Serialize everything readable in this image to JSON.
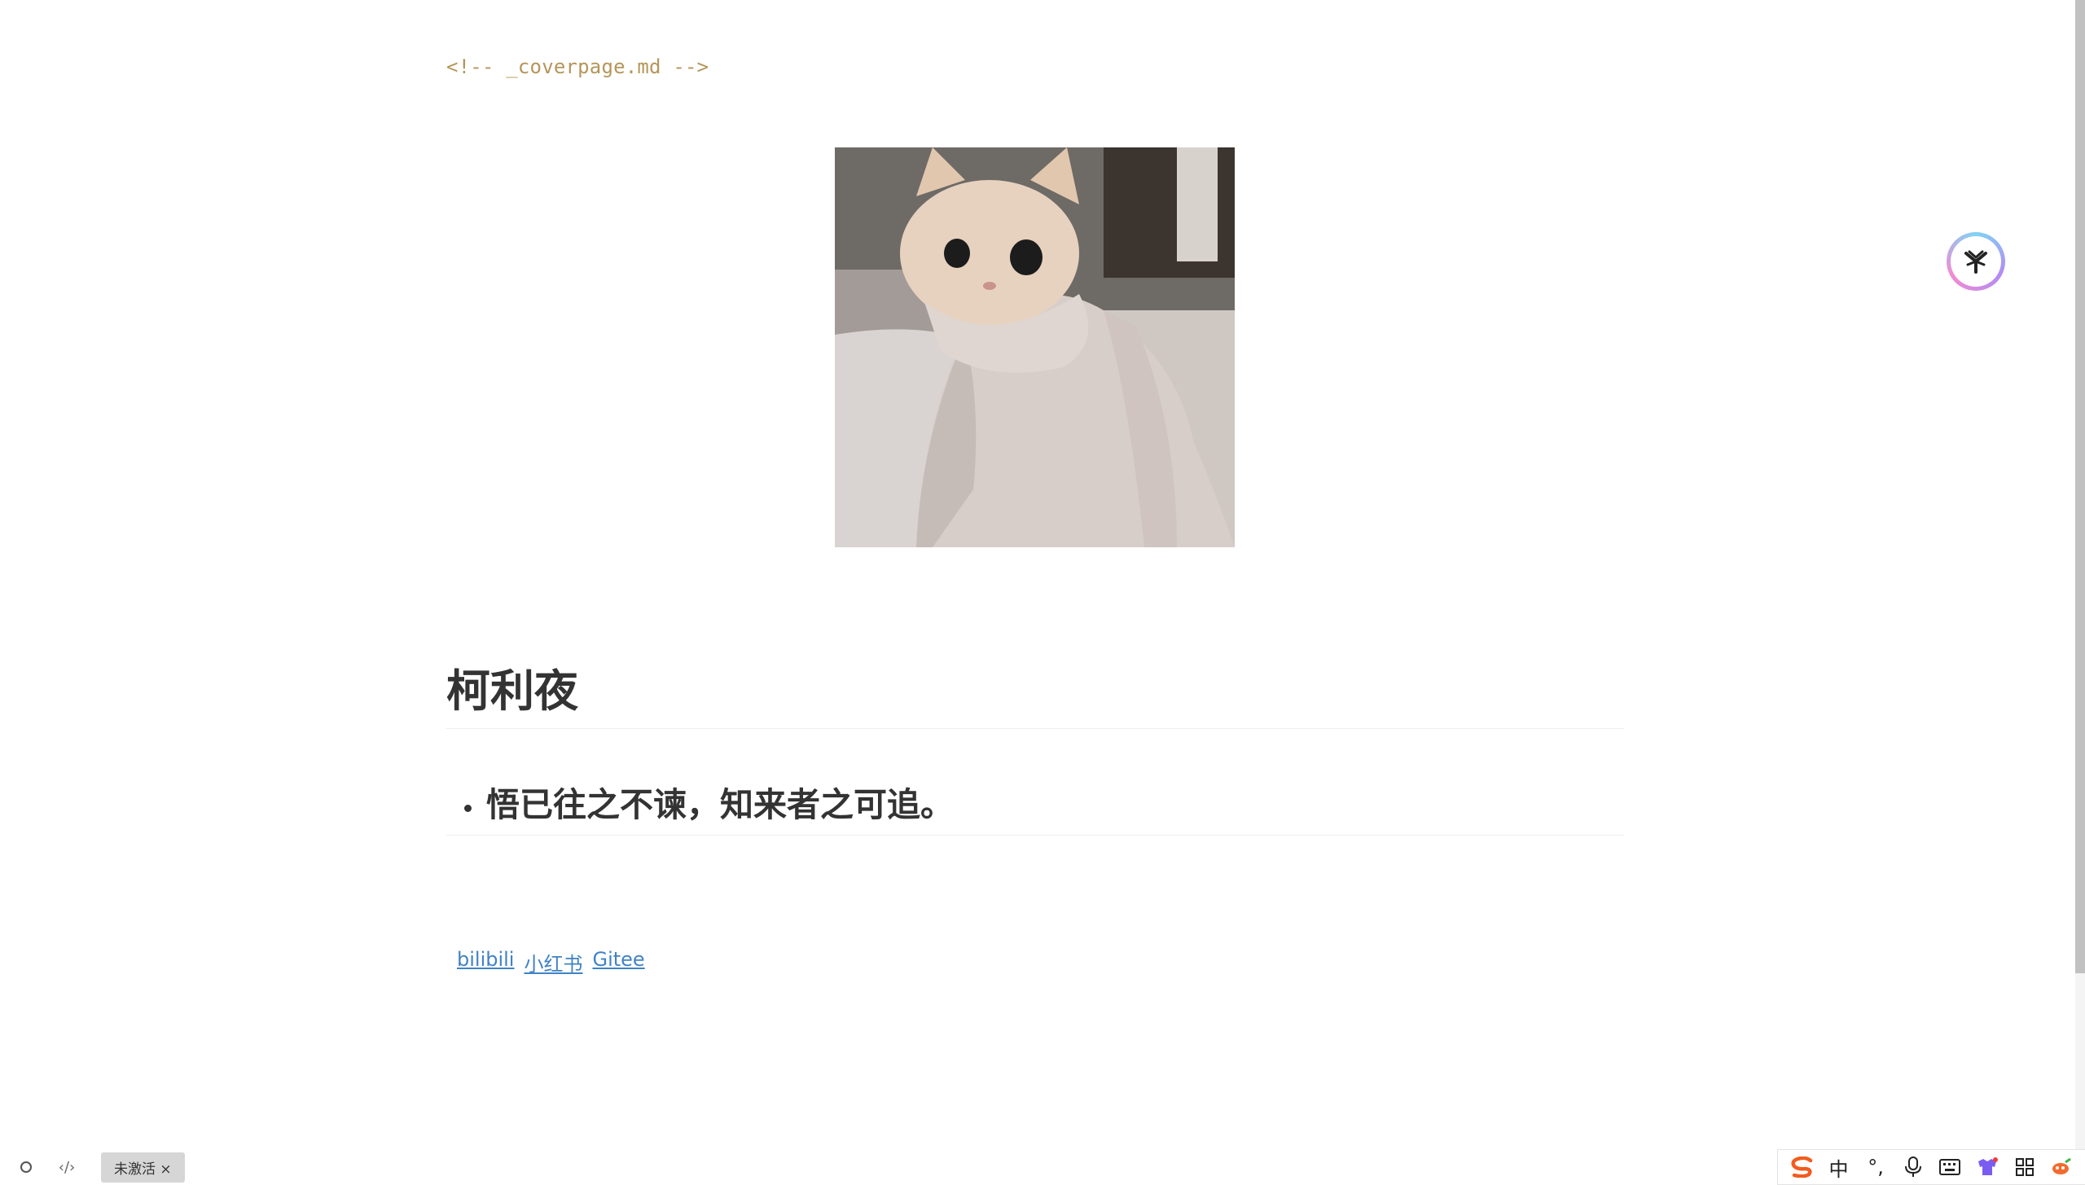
{
  "editor": {
    "html_comment": "<!-- _coverpage.md -->",
    "heading1": "柯利夜",
    "heading2": "悟已往之不谏，知来者之可追。",
    "links": [
      {
        "label": "bilibili"
      },
      {
        "label": "小红书"
      },
      {
        "label": "Gitee"
      }
    ]
  },
  "cover_image": {
    "alt": "cat wrapped in blanket"
  },
  "status_bar": {
    "inactive_label": "未激活 ×"
  },
  "ime_toolbar": {
    "logo_icon": "sogou-logo-icon",
    "mode_label": "中",
    "punct_label": "°,",
    "items": [
      "mic-icon",
      "keyboard-icon",
      "skin-icon",
      "grid-icon",
      "toolbox-icon"
    ]
  },
  "colors": {
    "comment": "#b5955a",
    "link": "#4183c4",
    "text": "#333333"
  }
}
